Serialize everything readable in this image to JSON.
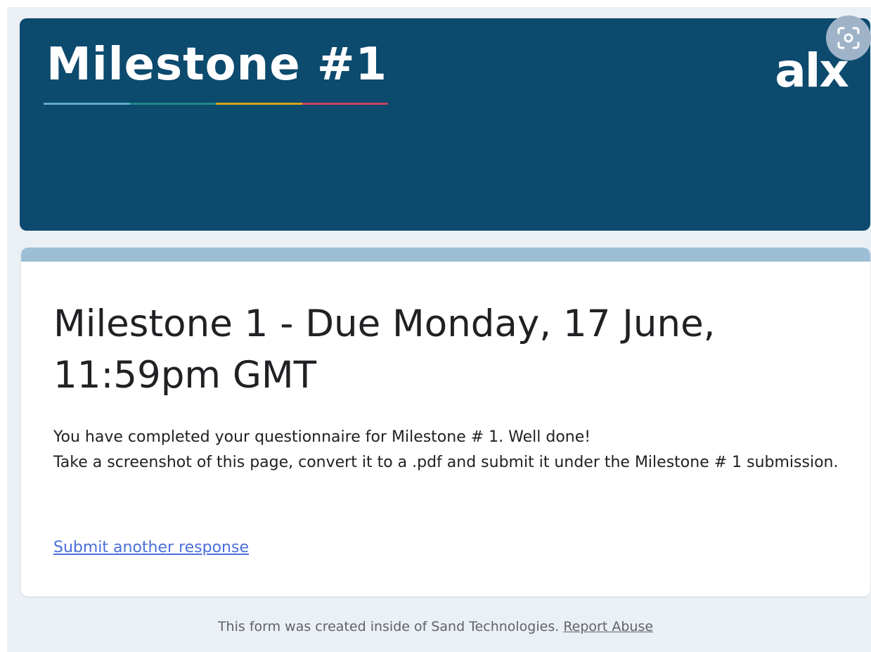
{
  "header": {
    "title": "Milestone #1",
    "logo_text": "alx",
    "background_color": "#0c4a6e",
    "underline_colors": [
      "#5fa8c9",
      "#1f8a8a",
      "#d4a517",
      "#c8445c"
    ]
  },
  "lens_button": {
    "icon": "google-lens-icon"
  },
  "card": {
    "accent_color": "#9cbfd6",
    "heading": "Milestone 1 - Due Monday, 17 June, 11:59pm GMT",
    "message_line1": "You have completed your questionnaire for Milestone # 1. Well done!",
    "message_line2": "Take a screenshot of this page, convert it to a .pdf and submit it under the Milestone # 1 submission.",
    "submit_another_link": "Submit another response"
  },
  "footer": {
    "text": "This form was created inside of Sand Technologies.",
    "report_link": "Report Abuse"
  }
}
